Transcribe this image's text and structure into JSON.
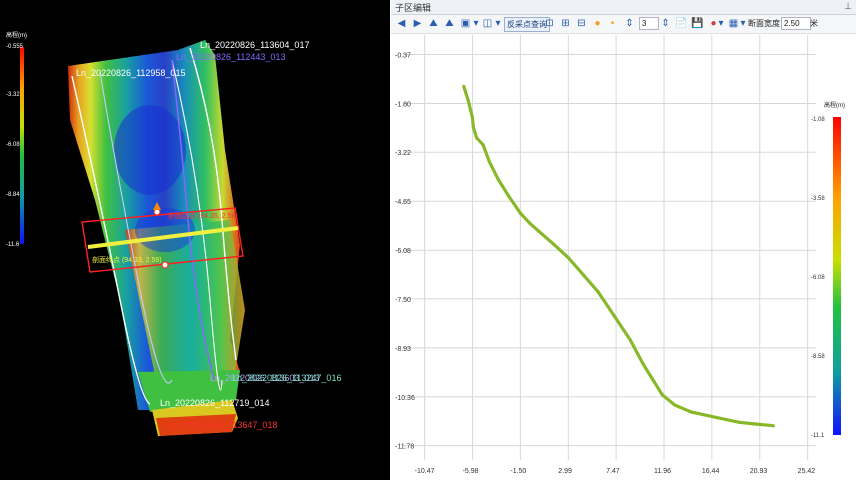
{
  "left_view": {
    "legend_title": "高程(m)",
    "legend_ticks": [
      "-0.555",
      "-3.32",
      "-6.08",
      "-8.84",
      "-11.6"
    ],
    "lines": [
      {
        "label": "Ln_20220826_113604_017",
        "color": "#ffffff"
      },
      {
        "label": "Ln_20220826_112443_013",
        "color": "#8866ff"
      },
      {
        "label": "Ln_20220826_112958_015",
        "color": "#ffffff"
      },
      {
        "label": "Ln_20220826_112719_014",
        "color": "#ffffff"
      },
      {
        "label": "Ln_20220826_113647_018",
        "color": "#ff3030"
      }
    ],
    "bottom_overlap_labels": [
      "Ln_20220826_113603_013",
      "Ln_20220826_113247_016"
    ],
    "section_start": "剖面起点 (94.35, 2.59)",
    "section_end": "剖面终点 (94.33, 2.59)"
  },
  "right_panel": {
    "title": "子区编辑",
    "pin_icon": "pin-icon",
    "toolbar": {
      "search_button": "反采点查询",
      "count_value": "3",
      "section_width_label": "断面宽度",
      "section_width_value": "2.50",
      "unit": "米"
    }
  },
  "chart_data": {
    "type": "scatter",
    "title": "",
    "xlabel": "",
    "ylabel": "",
    "x_ticks": [
      "-10.47",
      "-5.98",
      "-1.50",
      "2.99",
      "7.47",
      "11.96",
      "16.44",
      "20.93",
      "25.42"
    ],
    "y_ticks": [
      "-0.37",
      "-1.80",
      "-3.22",
      "-4.65",
      "-6.08",
      "-7.50",
      "-8.93",
      "-10.36",
      "-11.78"
    ],
    "xlim": [
      -12.5,
      26.2
    ],
    "ylim": [
      -12.2,
      0.2
    ],
    "grid": true,
    "series": [
      {
        "color": "#88b82a",
        "points": [
          [
            -6.8,
            -1.3
          ],
          [
            -6.4,
            -1.7
          ],
          [
            -6.0,
            -2.2
          ],
          [
            -5.9,
            -2.5
          ],
          [
            -5.6,
            -2.8
          ],
          [
            -5.0,
            -3.0
          ],
          [
            -4.4,
            -3.5
          ],
          [
            -3.6,
            -4.0
          ],
          [
            -2.6,
            -4.5
          ],
          [
            -1.5,
            -5.0
          ],
          [
            -0.6,
            -5.3
          ],
          [
            0.5,
            -5.6
          ],
          [
            1.6,
            -5.9
          ],
          [
            3.0,
            -6.3
          ],
          [
            4.4,
            -6.8
          ],
          [
            5.8,
            -7.3
          ],
          [
            7.3,
            -8.0
          ],
          [
            8.8,
            -8.7
          ],
          [
            10.0,
            -9.4
          ],
          [
            11.0,
            -9.9
          ],
          [
            11.8,
            -10.3
          ],
          [
            13.0,
            -10.6
          ],
          [
            14.5,
            -10.8
          ],
          [
            16.0,
            -10.9
          ],
          [
            17.5,
            -11.0
          ],
          [
            19.0,
            -11.1
          ],
          [
            20.5,
            -11.15
          ],
          [
            22.2,
            -11.2
          ]
        ]
      }
    ],
    "legend_title": "高程(m)",
    "legend_ticks": [
      "-1.08",
      "-3.58",
      "-6.08",
      "-8.58",
      "-11.1"
    ]
  }
}
